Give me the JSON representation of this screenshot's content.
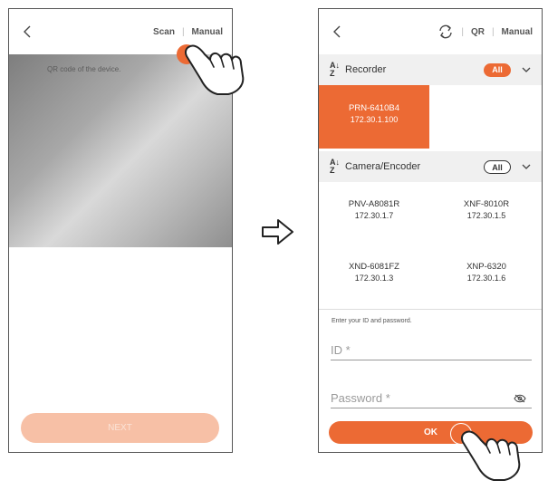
{
  "left_screen": {
    "scan_link": "Scan",
    "manual_link": "Manual",
    "scan_hint": "QR code of the device.",
    "next_label": "NEXT"
  },
  "right_screen": {
    "qr_link": "QR",
    "manual_link": "Manual",
    "recorder_section": {
      "title": "Recorder",
      "filter": "All",
      "devices": [
        {
          "model": "PRN-6410B4",
          "ip": "172.30.1.100",
          "selected": true
        }
      ]
    },
    "camera_section": {
      "title": "Camera/Encoder",
      "filter": "All",
      "devices": [
        {
          "model": "PNV-A8081R",
          "ip": "172.30.1.7"
        },
        {
          "model": "XNF-8010R",
          "ip": "172.30.1.5"
        },
        {
          "model": "XND-6081FZ",
          "ip": "172.30.1.3"
        },
        {
          "model": "XNP-6320",
          "ip": "172.30.1.6"
        }
      ]
    },
    "login": {
      "prompt": "Enter your ID and password.",
      "id_placeholder": "ID *",
      "password_placeholder": "Password *",
      "ok_label": "OK"
    }
  },
  "colors": {
    "accent": "#ec6a34",
    "accent_disabled": "#f7c0a6"
  },
  "icons": {
    "back": "chevron-left-icon",
    "refresh": "refresh-icon",
    "sort": "sort-az-icon",
    "collapse": "chevron-down-icon",
    "visibility": "eye-off-icon",
    "transition": "arrow-right-icon",
    "hand": "pointing-hand-icon"
  }
}
